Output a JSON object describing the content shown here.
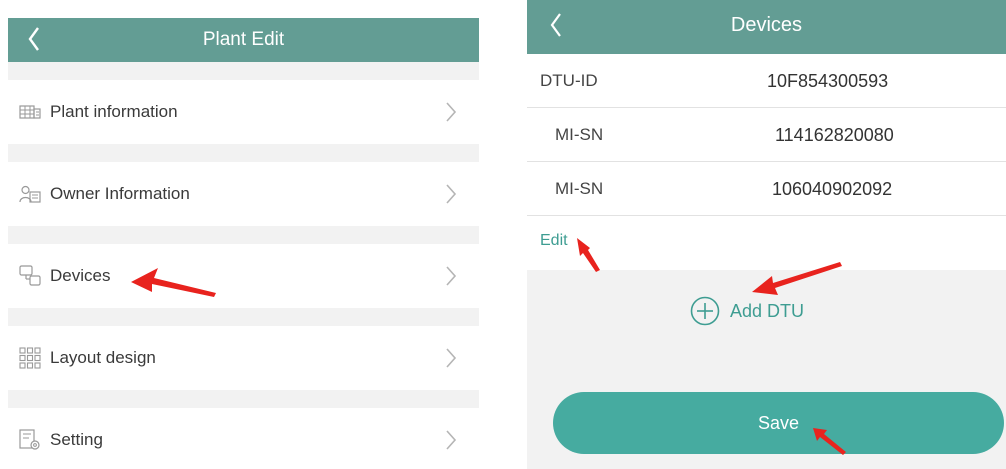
{
  "left_screen": {
    "header": {
      "title": "Plant Edit",
      "back_icon": "chevron-left-icon"
    },
    "menu": [
      {
        "label": "Plant information",
        "icon": "plant-info-icon"
      },
      {
        "label": "Owner Information",
        "icon": "owner-icon"
      },
      {
        "label": "Devices",
        "icon": "devices-icon"
      },
      {
        "label": "Layout design",
        "icon": "layout-grid-icon"
      },
      {
        "label": "Setting",
        "icon": "settings-icon"
      }
    ]
  },
  "right_screen": {
    "header": {
      "title": "Devices",
      "back_icon": "chevron-left-icon"
    },
    "devices": [
      {
        "key": "DTU-ID",
        "value": "10F854300593"
      },
      {
        "key": "MI-SN",
        "value": "114162820080"
      },
      {
        "key": "MI-SN",
        "value": "106040902092"
      }
    ],
    "edit_label": "Edit",
    "add_dtu_label": "Add DTU",
    "save_label": "Save"
  },
  "colors": {
    "header": "#639d94",
    "accent": "#3e9d92",
    "save_button": "#46aba0",
    "background": "#f2f2f2",
    "annotation_arrow": "#e8231e"
  }
}
